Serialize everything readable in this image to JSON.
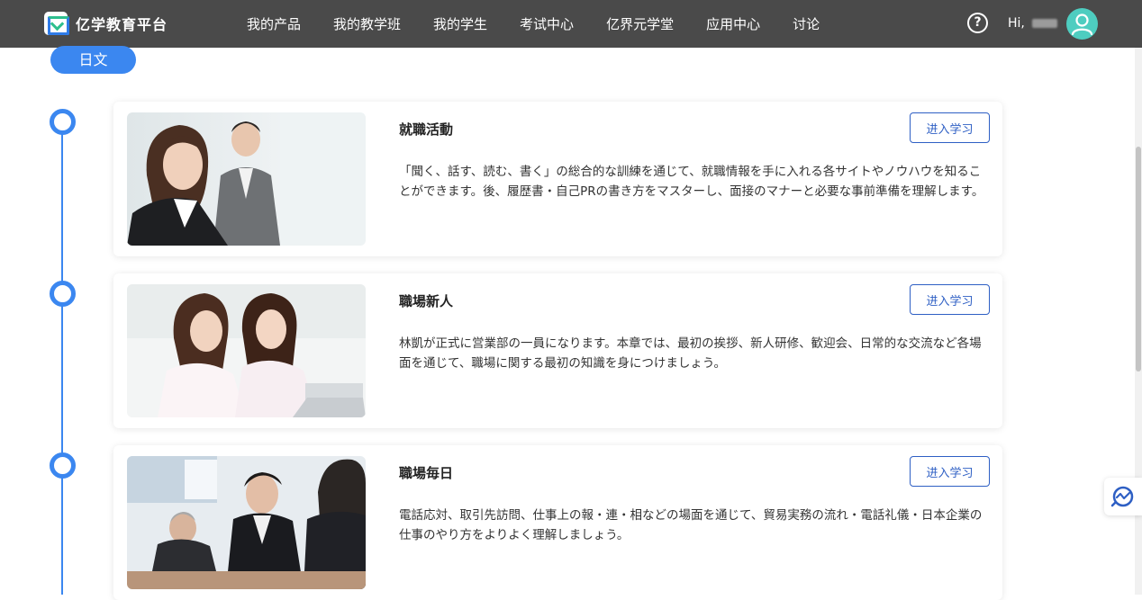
{
  "header": {
    "brand_title": "亿学教育平台",
    "nav": [
      "我的产品",
      "我的教学班",
      "我的学生",
      "考试中心",
      "亿界元学堂",
      "应用中心",
      "讨论"
    ],
    "help_icon": "?",
    "greeting": "Hi,"
  },
  "language_tag": "日文",
  "courses": [
    {
      "title": "就職活動",
      "description": "「聞く、話す、読む、書く」の総合的な訓練を通じて、就職情報を手に入れる各サイトやノウハウを知ることができます。後、履歴書・自己PRの書き方をマスターし、面接のマナーと必要な事前準備を理解します。",
      "button": "进入学习",
      "image_icon": "office-couple-photo"
    },
    {
      "title": "職場新人",
      "description": "林凱が正式に営業部の一員になります。本章では、最初の挨拶、新人研修、歓迎会、日常的な交流など各場面を通じて、職場に関する最初の知識を身につけましょう。",
      "button": "进入学习",
      "image_icon": "two-women-laptop-photo"
    },
    {
      "title": "職場毎日",
      "description": "電話応対、取引先訪問、仕事上の報・連・相などの場面を通じて、貿易実務の流れ・電話礼儀・日本企業の仕事のやり方をよりよく理解しましょう。",
      "button": "进入学习",
      "image_icon": "business-meeting-photo"
    }
  ],
  "colors": {
    "topbar": "#4a4a4a",
    "accent": "#3b87f0",
    "button_text": "#2e5fc4",
    "avatar": "#4ecdc0"
  }
}
